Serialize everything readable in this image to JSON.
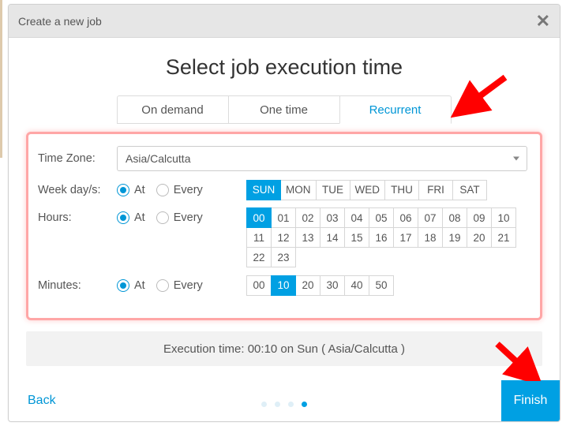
{
  "header": {
    "title": "Create a new job"
  },
  "heading": "Select job execution time",
  "tabs": {
    "on_demand": "On demand",
    "one_time": "One time",
    "recurrent": "Recurrent",
    "active": "recurrent"
  },
  "form": {
    "timezone_label": "Time Zone:",
    "timezone_value": "Asia/Calcutta",
    "weekday_label": "Week day/s:",
    "hours_label": "Hours:",
    "minutes_label": "Minutes:",
    "radio_at": "At",
    "radio_every": "Every",
    "weekday": {
      "mode": "at",
      "options": [
        "SUN",
        "MON",
        "TUE",
        "WED",
        "THU",
        "FRI",
        "SAT"
      ],
      "selected": [
        "SUN"
      ]
    },
    "hours": {
      "mode": "at",
      "options": [
        "00",
        "01",
        "02",
        "03",
        "04",
        "05",
        "06",
        "07",
        "08",
        "09",
        "10",
        "11",
        "12",
        "13",
        "14",
        "15",
        "16",
        "17",
        "18",
        "19",
        "20",
        "21",
        "22",
        "23"
      ],
      "selected": [
        "00"
      ]
    },
    "minutes": {
      "mode": "at",
      "options": [
        "00",
        "10",
        "20",
        "30",
        "40",
        "50"
      ],
      "selected": [
        "10"
      ]
    }
  },
  "summary": "Execution time: 00:10 on Sun ( Asia/Calcutta )",
  "footer": {
    "back": "Back",
    "finish": "Finish",
    "steps_total": 4,
    "step_current": 4
  },
  "colors": {
    "accent": "#00a0e3"
  }
}
